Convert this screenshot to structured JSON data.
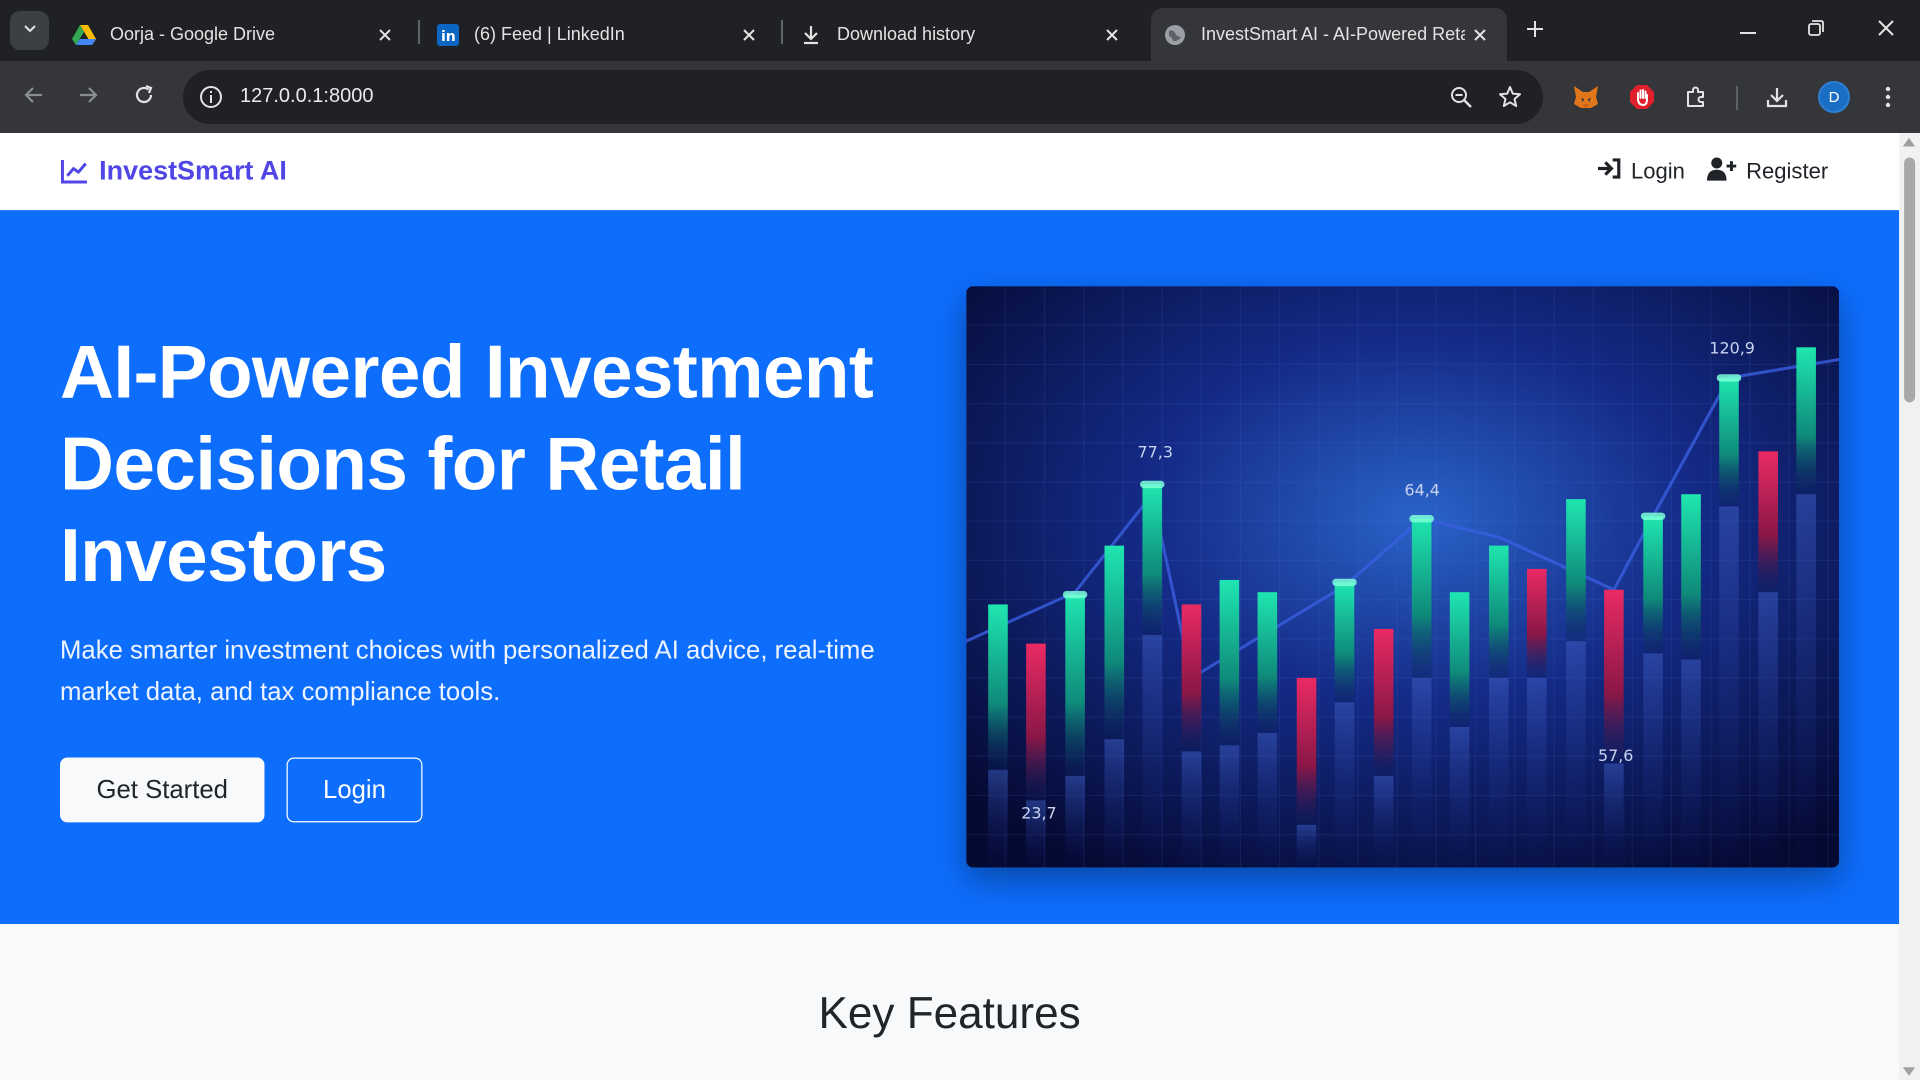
{
  "browser": {
    "tabs": [
      {
        "title": "Oorja - Google Drive",
        "icon": "google-drive-icon",
        "active": false
      },
      {
        "title": "(6) Feed | LinkedIn",
        "icon": "linkedin-icon",
        "active": false
      },
      {
        "title": "Download history",
        "icon": "download-icon",
        "active": false
      },
      {
        "title": "InvestSmart AI - AI-Powered Retail",
        "icon": "globe-icon",
        "active": true
      }
    ],
    "url": "127.0.0.1:8000",
    "profile_initial": "D",
    "colors": {
      "tabstrip": "#202124",
      "toolbar": "#35363a",
      "omnibox": "#202124"
    }
  },
  "site": {
    "brand": "InvestSmart AI",
    "brand_color": "#4f46e5",
    "nav": {
      "login": "Login",
      "register": "Register"
    },
    "hero": {
      "title": "AI-Powered Investment Decisions for Retail Investors",
      "subtitle": "Make smarter investment choices with personalized AI advice, real-time market data, and tax compliance tools.",
      "primary_button": "Get Started",
      "secondary_button": "Login",
      "background": "#0d6efd"
    },
    "hero_image": {
      "labels": [
        "77,3",
        "64,4",
        "120,9",
        "23,7",
        "57,6"
      ],
      "colors": {
        "up": "#18e0a8",
        "down": "#e0245e",
        "bg": "#0a1460"
      }
    },
    "features": {
      "heading": "Key Features"
    }
  }
}
